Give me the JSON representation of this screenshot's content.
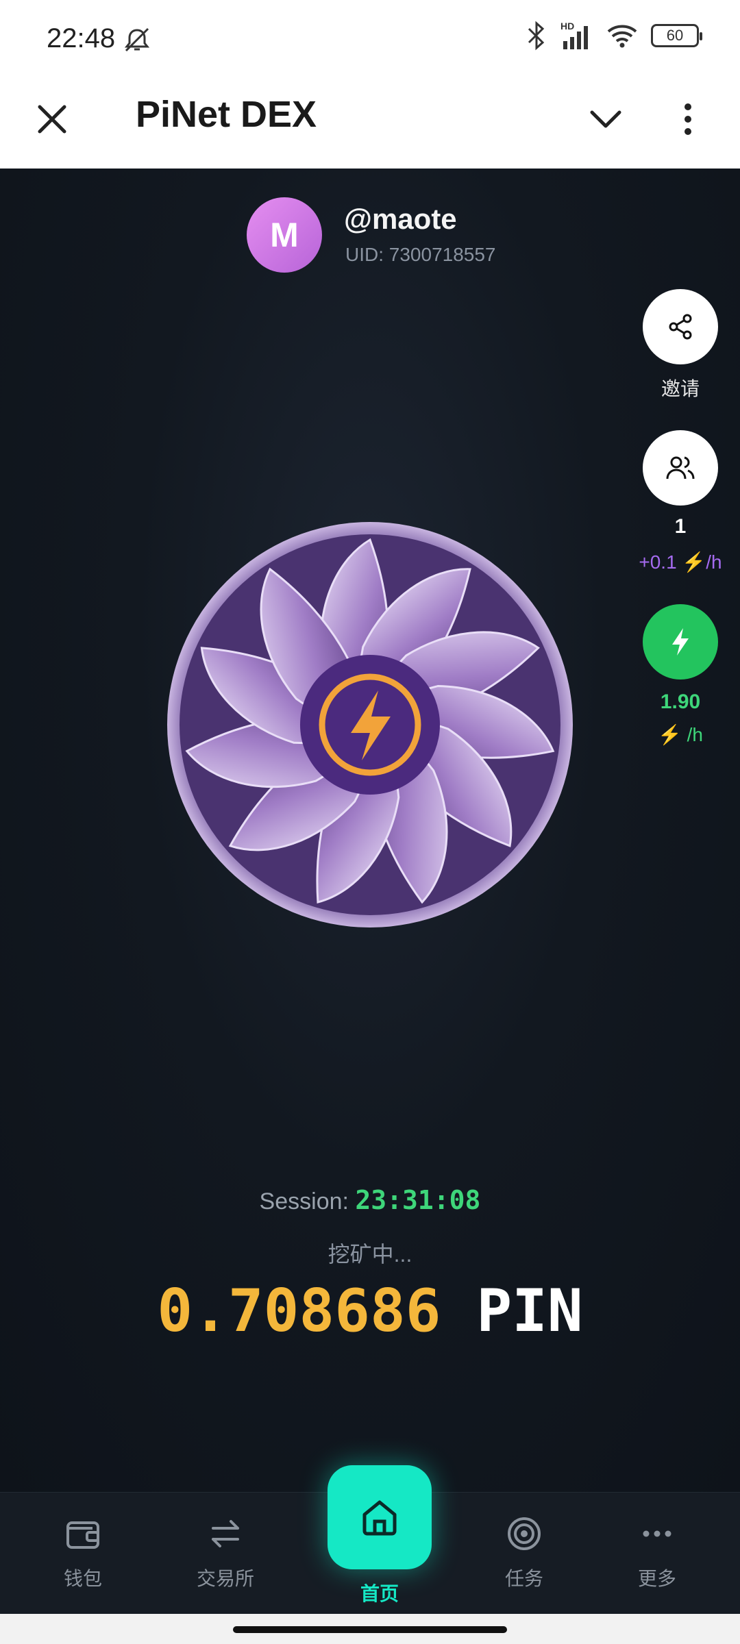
{
  "status_bar": {
    "time": "22:48",
    "battery": "60",
    "network": "HD"
  },
  "app_bar": {
    "title": "PiNet DEX"
  },
  "profile": {
    "avatar_letter": "M",
    "username": "@maote",
    "uid": "UID: 7300718557"
  },
  "side_actions": {
    "invite_label": "邀请",
    "team_count": "1",
    "team_rate": "+0.1 ⚡/h",
    "boost_rate": "1.90",
    "boost_unit": "⚡ /h"
  },
  "session": {
    "label": "Session: ",
    "time": "23:31:08"
  },
  "mining_status": "挖矿中...",
  "balance": {
    "amount": "0.708686",
    "unit": "PIN"
  },
  "bottom_nav": {
    "wallet": "钱包",
    "exchange": "交易所",
    "home": "首页",
    "tasks": "任务",
    "more": "更多"
  },
  "colors": {
    "accent": "#15e8c5",
    "balance": "#f4b73b",
    "green": "#3ed67a",
    "purple": "#a56bf0"
  }
}
